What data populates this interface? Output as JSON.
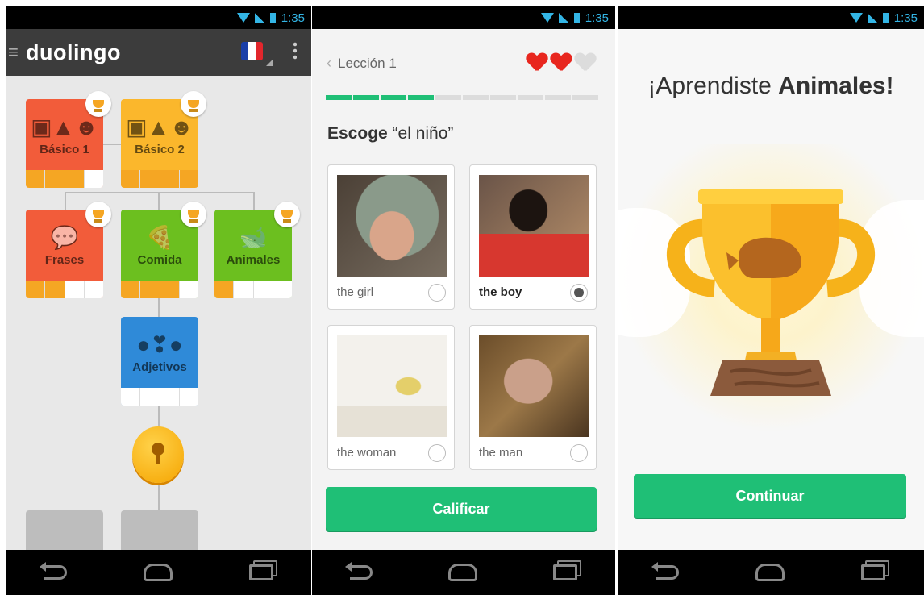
{
  "status": {
    "time": "1:35"
  },
  "skill_tree": {
    "logo": "duolingo",
    "skills": [
      {
        "name": "Básico 1",
        "glyph": "▣▲☻",
        "color": "#f25c3a",
        "bar_color": "#f5a623",
        "progress": 0.75,
        "trophy": true
      },
      {
        "name": "Básico 2",
        "glyph": "▣▲☻",
        "color": "#fbb72c",
        "bar_color": "#f5a623",
        "progress": 1.0,
        "trophy": true
      },
      {
        "name": "Frases",
        "glyph": "💬",
        "color": "#f25c3a",
        "bar_color": "#f5a623",
        "progress": 0.5,
        "trophy": true
      },
      {
        "name": "Comida",
        "glyph": "🍕",
        "color": "#6cbf1f",
        "bar_color": "#f5a623",
        "progress": 0.75,
        "trophy": true
      },
      {
        "name": "Animales",
        "glyph": "🐋",
        "color": "#6cbf1f",
        "bar_color": "#f5a623",
        "progress": 0.25,
        "trophy": true
      },
      {
        "name": "Adjetivos",
        "glyph": "●❣●",
        "color": "#2f8ad8",
        "bar_color": "#ffffff",
        "progress": 0.0,
        "trophy": false
      }
    ]
  },
  "lesson": {
    "title": "Lección 1",
    "hearts": [
      "full",
      "full",
      "empty"
    ],
    "progress_steps": 10,
    "progress_done": 4,
    "prompt_bold": "Escoge",
    "prompt_rest": " “el niño”",
    "options": [
      {
        "label": "the girl",
        "selected": false
      },
      {
        "label": "the boy",
        "selected": true
      },
      {
        "label": "the woman",
        "selected": false
      },
      {
        "label": "the man",
        "selected": false
      }
    ],
    "check_label": "Calificar"
  },
  "complete": {
    "heading_pre": "¡Aprendiste ",
    "heading_bold": "Animales!",
    "continue_label": "Continuar"
  },
  "colors": {
    "green": "#1fbf76",
    "heart_red": "#e8261e",
    "heart_empty": "#dcdcdc"
  }
}
